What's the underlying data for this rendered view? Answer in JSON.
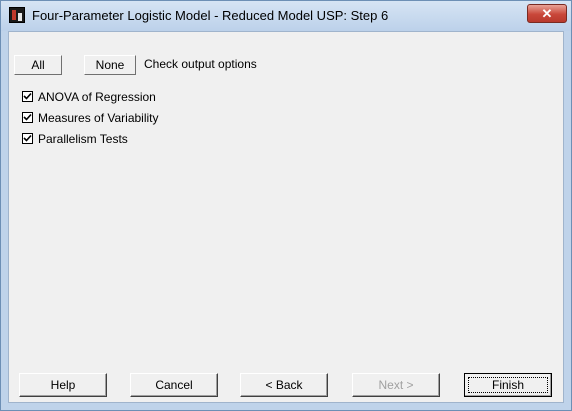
{
  "window": {
    "title": "Four-Parameter Logistic Model - Reduced Model USP: Step 6"
  },
  "toolbar": {
    "all_label": "All",
    "none_label": "None",
    "hint": "Check output options"
  },
  "options": [
    {
      "label": "ANOVA of Regression",
      "checked": true
    },
    {
      "label": "Measures of Variability",
      "checked": true
    },
    {
      "label": "Parallelism Tests",
      "checked": true
    }
  ],
  "buttons": {
    "help": "Help",
    "cancel": "Cancel",
    "back": "< Back",
    "next": "Next >",
    "finish": "Finish"
  },
  "colors": {
    "title_bar": "#bcd1ea",
    "close_button": "#c9473a",
    "dialog_bg": "#f0f0f0"
  },
  "icons": {
    "app": "app-icon",
    "close": "close-icon",
    "check": "checkmark-icon"
  }
}
